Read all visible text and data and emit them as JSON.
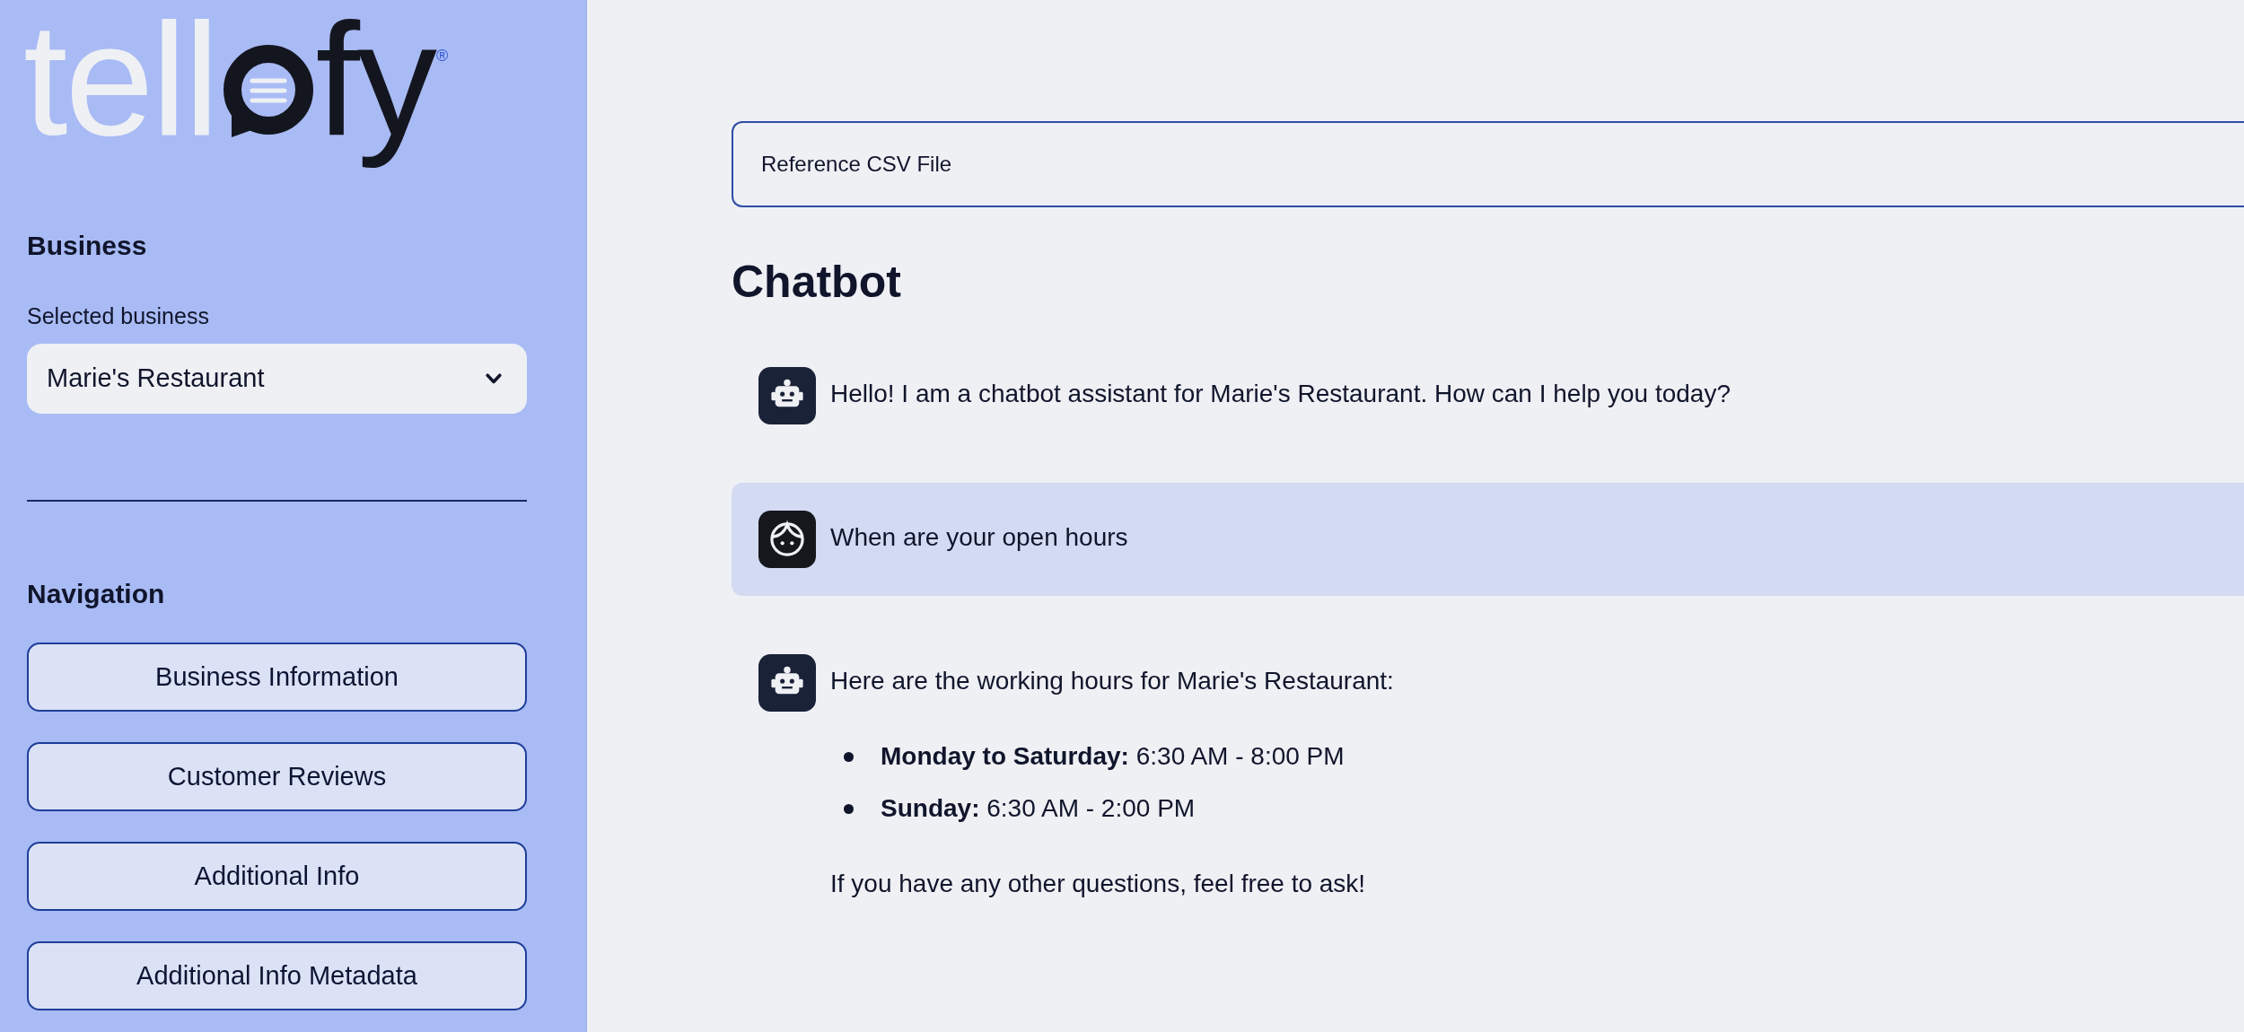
{
  "logo": {
    "left": "tell",
    "right": "fy",
    "registered": "®"
  },
  "sidebar": {
    "business_heading": "Business",
    "select": {
      "label": "Selected business",
      "value": "Marie's Restaurant"
    },
    "navigation_heading": "Navigation",
    "nav_buttons": [
      "Business Information",
      "Customer Reviews",
      "Additional Info",
      "Additional Info Metadata"
    ]
  },
  "main": {
    "expander": {
      "label": "Reference CSV File"
    },
    "title": "Chatbot",
    "messages": [
      {
        "kind": "bot",
        "blocks": [
          {
            "kind": "paragraph",
            "text": "Hello! I am a chatbot assistant for Marie's Restaurant. How can I help you today?"
          }
        ]
      },
      {
        "kind": "user",
        "blocks": [
          {
            "kind": "paragraph",
            "text": "When are your open hours"
          }
        ]
      },
      {
        "kind": "bot",
        "blocks": [
          {
            "kind": "paragraph",
            "text": "Here are the working hours for Marie's Restaurant:"
          },
          {
            "kind": "list",
            "items": [
              "**Monday to Saturday:** 6:30 AM - 8:00 PM",
              "**Sunday:** 6:30 AM - 2:00 PM"
            ]
          },
          {
            "kind": "paragraph",
            "text": "If you have any other questions, feel free to ask!"
          }
        ]
      }
    ]
  }
}
